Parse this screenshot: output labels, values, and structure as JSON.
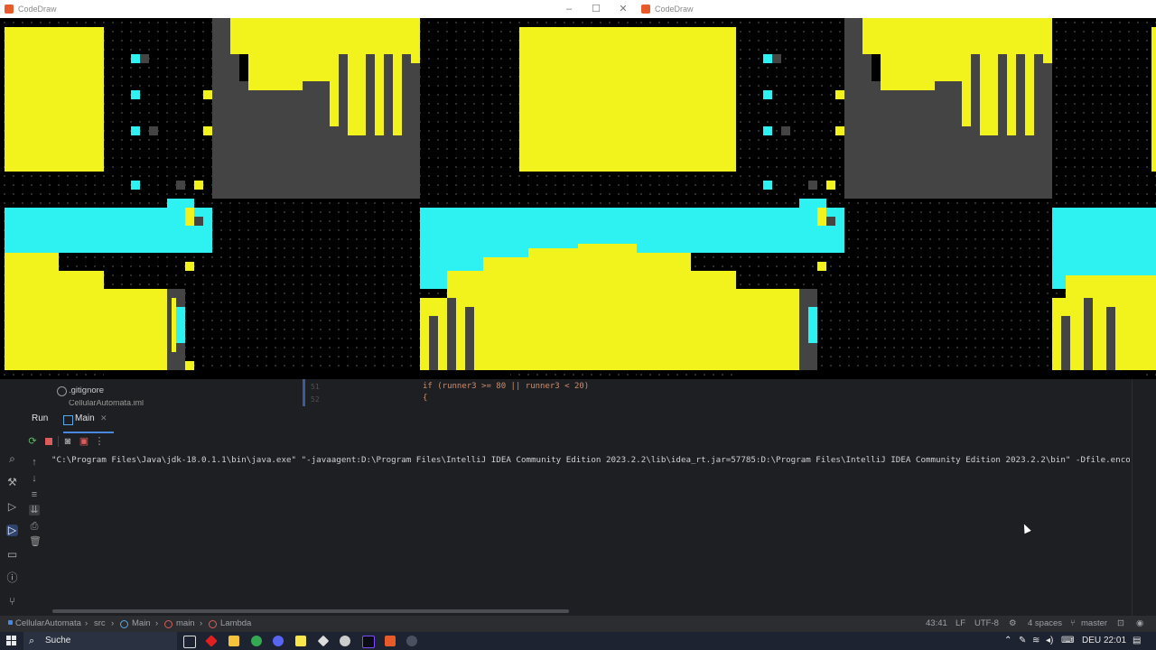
{
  "windows": [
    {
      "title": "CodeDraw",
      "controls": [
        "–",
        "☐",
        "✕"
      ]
    },
    {
      "title": "CodeDraw"
    }
  ],
  "editor": {
    "project_file": ".gitignore",
    "project_file2": "CellularAutomata.iml",
    "line_numbers": [
      "51",
      "52"
    ],
    "code_line1": "if (runner3 >= 80 || runner3 < 20)",
    "code_line2": "{"
  },
  "run_panel": {
    "label": "Run",
    "tab": "Main",
    "command": "\"C:\\Program Files\\Java\\jdk-18.0.1.1\\bin\\java.exe\" \"-javaagent:D:\\Program Files\\IntelliJ IDEA Community Edition 2023.2.2\\lib\\idea_rt.jar=57785:D:\\Program Files\\IntelliJ IDEA Community Edition 2023.2.2\\bin\" -Dfile.encoding=UTF"
  },
  "statusbar": {
    "breadcrumbs": [
      "CellularAutomata",
      "src",
      "Main",
      "main",
      "Lambda"
    ],
    "position": "43:41",
    "line_sep": "LF",
    "encoding": "UTF-8",
    "indent": "4 spaces",
    "branch": "master"
  },
  "taskbar": {
    "search_label": "Suche",
    "language": "DEU",
    "time": "22:01"
  },
  "colors": {
    "yellow": "#f2f21c",
    "cyan": "#2ef2f2",
    "grey": "#444444",
    "accent": "#4a88e0"
  }
}
